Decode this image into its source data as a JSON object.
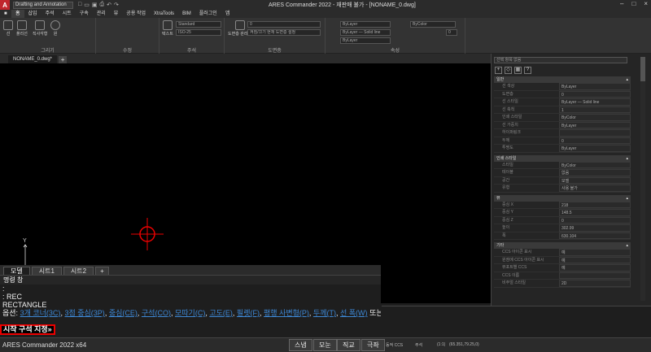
{
  "titlebar": {
    "workspace": "Drafting and Annotation",
    "title": "ARES Commander 2022 - 재판매 불가 - [NONAME_0.dwg]",
    "logo": "A"
  },
  "menu": [
    "홈",
    "삽입",
    "주석",
    "시트",
    "구속",
    "관리",
    "뷰",
    "공용 작업",
    "XtraTools",
    "BIM",
    "플러그인",
    "앱"
  ],
  "ribbon": {
    "panels": [
      "그리기",
      "수정",
      "주석",
      "도면층",
      "속성"
    ],
    "draw_buttons": [
      "선",
      "폴리선",
      "직사각형",
      "원"
    ],
    "annotation_buttons": [
      "텍스트",
      "치수",
      "표"
    ],
    "layer_button": "도면층 관리자",
    "style_combo": "Standard",
    "dim_combo": "ISO-25",
    "layer_combo": "0",
    "layer_combo2": "켜짐/끄기 현재 도면층 설정",
    "bylayer1": "ByLayer",
    "bylayer2": "ByLayer — Solid line",
    "bylayer3": "ByLayer",
    "bycolor": "ByColor",
    "transparency": "0"
  },
  "doctab": "NONAME_0.dwg*",
  "layout_tabs": [
    "모델",
    "시트1",
    "시트2"
  ],
  "command": {
    "title": "명령 창",
    "lines": [
      ":",
      ": REC",
      "RECTANGLE"
    ],
    "options_label": "옵션:",
    "options": [
      "3개 코너(3C)",
      "3점 중심(3P)",
      "중심(CE)",
      "구석(CO)",
      "모따기(C)",
      "고도(E)",
      "필렛(F)",
      "평행 사변형(P)",
      "두께(T)",
      "선 폭(W)"
    ],
    "options_tail": "또는",
    "prompt": "시작 구석 지정»"
  },
  "status": {
    "app": "ARES Commander 2022 x64",
    "buttons": [
      "스냅",
      "모눈",
      "직교",
      "극좌"
    ],
    "right": [
      "동적 CCS",
      "주석",
      "(1:1)",
      "(65.351,79.25,0)"
    ]
  },
  "properties": {
    "selector": "선택 항목 없음",
    "icons": [
      "+",
      "◇",
      "▦",
      "?"
    ],
    "sections": [
      {
        "title": "일반",
        "rows": [
          [
            "선 색상",
            "ByLayer"
          ],
          [
            "도면층",
            "0"
          ],
          [
            "선 스타일",
            "ByLayer — Solid line"
          ],
          [
            "선 축척",
            "1"
          ],
          [
            "인쇄 스타일",
            "ByColor"
          ],
          [
            "선 가중치",
            "ByLayer"
          ],
          [
            "하이퍼링크",
            ""
          ],
          [
            "두께",
            "0"
          ],
          [
            "투명도",
            "ByLayer"
          ]
        ]
      },
      {
        "title": "인쇄 스타일",
        "rows": [
          [
            "스타일",
            "ByColor"
          ],
          [
            "테이블",
            "없음"
          ],
          [
            "공간",
            "모델"
          ],
          [
            "유형",
            "사용 불가"
          ]
        ]
      },
      {
        "title": "뷰",
        "rows": [
          [
            "중심 X",
            "218"
          ],
          [
            "중심 Y",
            "148.5"
          ],
          [
            "중심 Z",
            "0"
          ],
          [
            "높이",
            "302.99"
          ],
          [
            "폭",
            "630.104"
          ]
        ]
      },
      {
        "title": "기타",
        "rows": [
          [
            "CCS 아이콘 표시",
            "예"
          ],
          [
            "원점에 CCS 아이콘 표시",
            "예"
          ],
          [
            "뷰포트별 CCS",
            "예"
          ],
          [
            "CCS 이름",
            ""
          ],
          [
            "비주얼 스타일",
            "2D"
          ]
        ]
      }
    ]
  }
}
